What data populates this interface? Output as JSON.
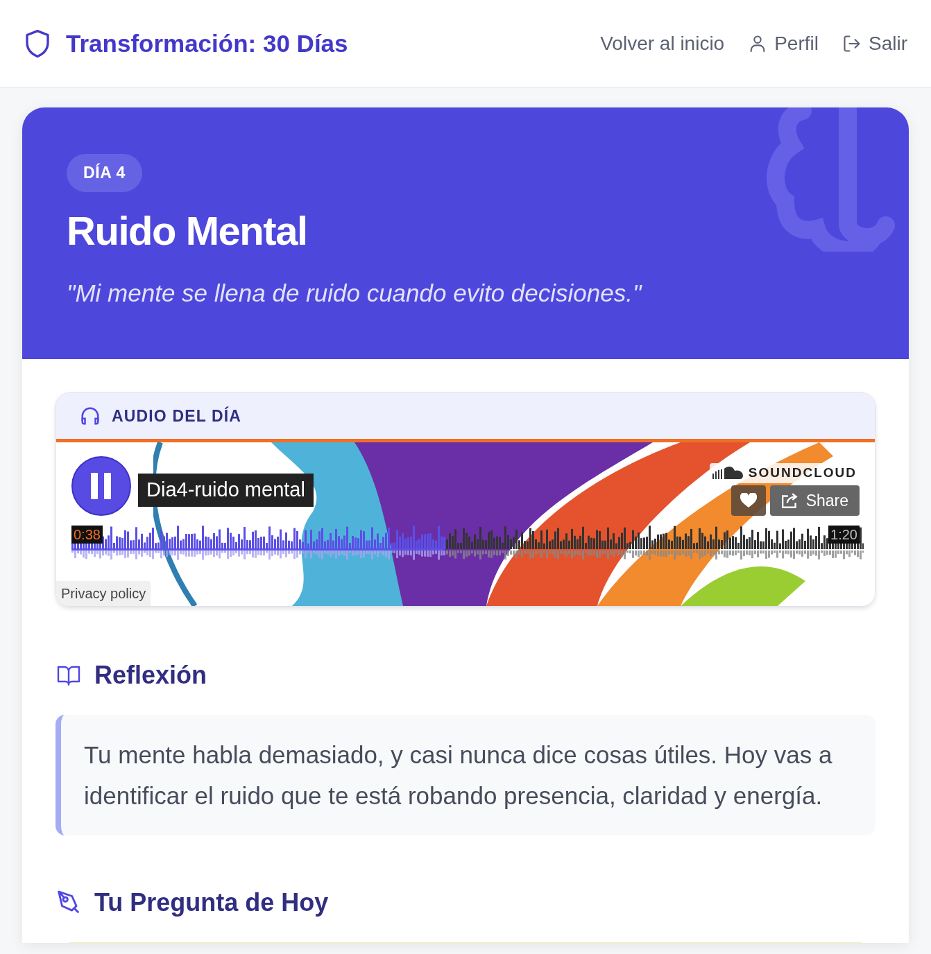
{
  "header": {
    "title": "Transformación: 30 Días",
    "nav": [
      {
        "label": "Volver al inicio"
      },
      {
        "label": "Perfil"
      },
      {
        "label": "Salir"
      }
    ]
  },
  "hero": {
    "badge": "DÍA 4",
    "title": "Ruido Mental",
    "quote": "\"Mi mente se llena de ruido cuando evito decisiones.\""
  },
  "audio": {
    "heading": "AUDIO DEL DÍA",
    "player": {
      "track": "Dia4-ruido mental",
      "playing": true,
      "brand": "SOUNDCLOUD",
      "share": "Share",
      "elapsed": "0:38",
      "duration": "1:20",
      "level": 0.47,
      "privacy": "Privacy policy"
    }
  },
  "reflection": {
    "heading": "Reflexión",
    "text": "Tu mente habla demasiado, y casi nunca dice cosas útiles. Hoy vas a identificar el ruido que te está robando presencia, claridad y energía."
  },
  "question": {
    "heading": "Tu Pregunta de Hoy"
  }
}
